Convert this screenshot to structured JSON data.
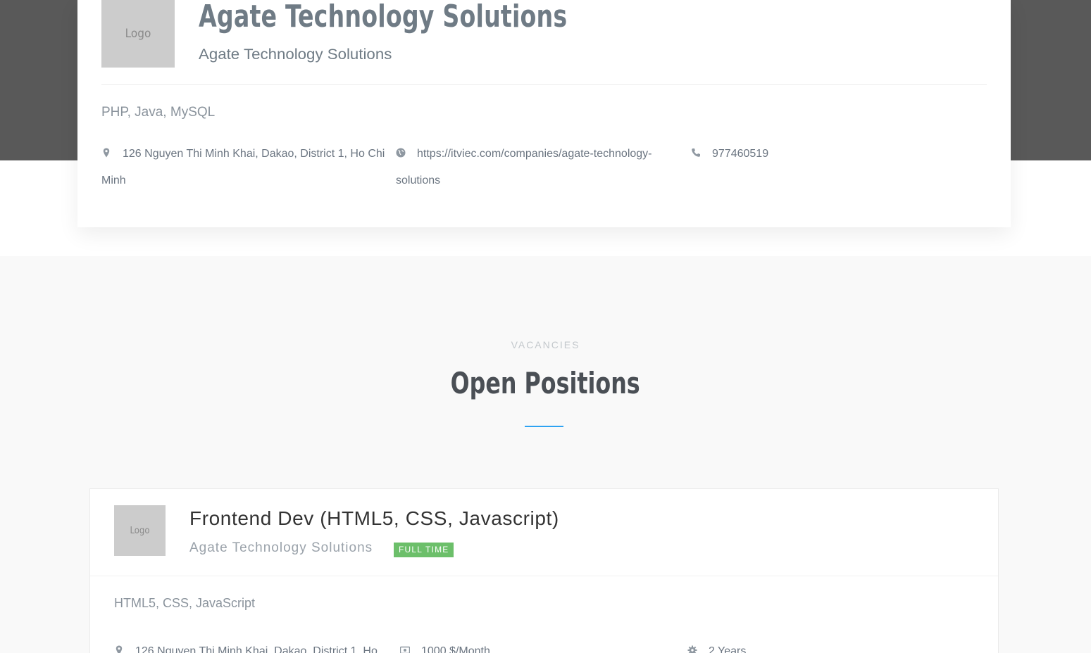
{
  "company": {
    "logo_text": "Logo",
    "name": "Agate Technology Solutions",
    "tagline": "Agate Technology Solutions",
    "skills": "PHP, Java, MySQL",
    "address": "126 Nguyen Thi Minh Khai, Dakao, District 1, Ho Chi Minh",
    "website": "https://itviec.com/companies/agate-technology-solutions",
    "phone": "977460519"
  },
  "vacancies": {
    "eyebrow": "VACANCIES",
    "title": "Open Positions",
    "accent_color": "#2ea3f2"
  },
  "jobs": [
    {
      "logo_text": "Logo",
      "title": "Frontend Dev (HTML5, CSS, Javascript)",
      "company": "Agate Technology Solutions",
      "type": "FULL TIME",
      "type_color": "#6cbf6a",
      "skills": "HTML5, CSS, JavaScript",
      "location": "126 Nguyen Thi Minh Khai, Dakao, District 1, Ho",
      "salary": "1000 $/Month",
      "experience": "2 Years"
    }
  ],
  "icons": {
    "address": "map-marker-icon",
    "website": "globe-icon",
    "phone": "phone-icon",
    "salary": "money-icon",
    "experience": "gear-icon"
  }
}
